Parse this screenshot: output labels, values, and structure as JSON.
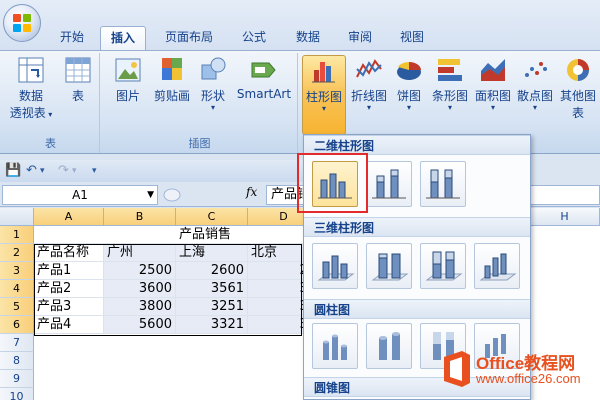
{
  "ribbon_tabs": [
    "开始",
    "插入",
    "页面布局",
    "公式",
    "数据",
    "审阅",
    "视图"
  ],
  "active_tab": "插入",
  "groups": {
    "table": {
      "label": "表",
      "buttons": {
        "pivot": "数据",
        "pivot2": "透视表",
        "table": "表"
      }
    },
    "illustrations": {
      "label": "插图",
      "buttons": {
        "picture": "图片",
        "clipart": "剪贴画",
        "shapes": "形状",
        "smartart": "SmartArt"
      }
    },
    "charts": {
      "buttons": {
        "column": "柱形图",
        "line": "折线图",
        "pie": "饼图",
        "bar": "条形图",
        "area": "面积图",
        "scatter": "散点图",
        "other": "其他图表"
      }
    }
  },
  "formula_bar": {
    "name_box": "A1",
    "fx": "fx",
    "content": "产品销售"
  },
  "sheet": {
    "columns": [
      "A",
      "B",
      "C",
      "D",
      "H"
    ],
    "rows": [
      "1",
      "2",
      "3",
      "4",
      "5",
      "6",
      "7",
      "8",
      "9",
      "10"
    ],
    "title": "产品销售",
    "headers": [
      "产品名称",
      "广州",
      "上海",
      "北京"
    ],
    "data": [
      {
        "name": "产品1",
        "b": "2500",
        "c": "2600",
        "d": "25"
      },
      {
        "name": "产品2",
        "b": "3600",
        "c": "3561",
        "d": "36"
      },
      {
        "name": "产品3",
        "b": "3800",
        "c": "3251",
        "d": "39"
      },
      {
        "name": "产品4",
        "b": "5600",
        "c": "3321",
        "d": "35"
      }
    ]
  },
  "gallery": {
    "sections": [
      "二维柱形图",
      "三维柱形图",
      "圆柱图",
      "圆锥图"
    ]
  },
  "watermark": {
    "text": "Office教程网",
    "url": "www.office26.com"
  },
  "colors": {
    "accent": "#15428b",
    "highlight_border": "#e32b2b",
    "watermark": "#e8501f"
  }
}
